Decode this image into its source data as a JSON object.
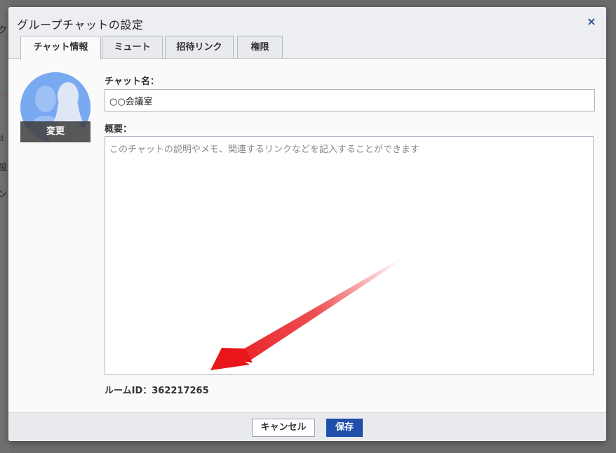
{
  "background": {
    "glyphs": [
      "ク",
      "社",
      "設",
      "ン"
    ]
  },
  "dialog": {
    "title": "グループチャットの設定",
    "close_icon": "×",
    "tabs": [
      {
        "label": "チャット情報",
        "active": true
      },
      {
        "label": "ミュート",
        "active": false
      },
      {
        "label": "招待リンク",
        "active": false
      },
      {
        "label": "権限",
        "active": false
      }
    ]
  },
  "avatar": {
    "icon": "group-avatar-icon",
    "change_label": "変更"
  },
  "form": {
    "name_label": "チャット名：",
    "name_value": "○○会議室",
    "desc_label": "概要：",
    "desc_placeholder": "このチャットの説明やメモ、関連するリンクなどを記入することができます",
    "room_id_text": "ルームID：362217265"
  },
  "footer": {
    "cancel_label": "キャンセル",
    "save_label": "保存"
  },
  "colors": {
    "accent": "#1f4fa8",
    "avatar_bg": "#78a9f1",
    "arrow": "#e8151b"
  }
}
